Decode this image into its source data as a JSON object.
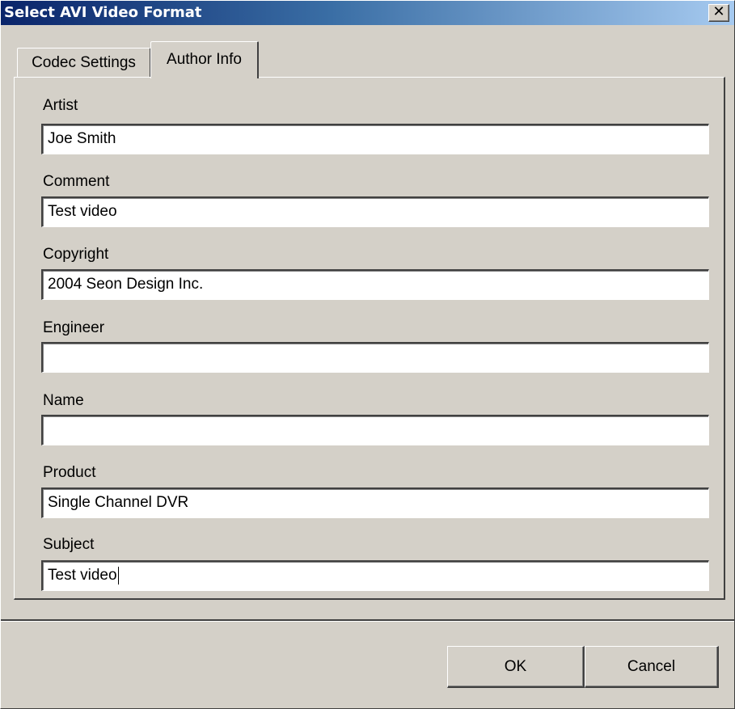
{
  "window": {
    "title": "Select AVI Video Format",
    "close_glyph": "✕"
  },
  "tabs": [
    {
      "label": "Codec Settings",
      "selected": false
    },
    {
      "label": "Author Info",
      "selected": true
    }
  ],
  "fields": [
    {
      "label": "Artist",
      "value": ""
    },
    {
      "label": "Comment",
      "value": ""
    },
    {
      "label": "Copyright",
      "value": ""
    },
    {
      "label": "Engineer",
      "value": ""
    },
    {
      "label": "Name",
      "value": ""
    },
    {
      "label": "Product",
      "value": ""
    },
    {
      "label": "Subject",
      "value": ""
    }
  ],
  "field_values": {
    "artist": "Joe Smith",
    "comment": "Test video",
    "copyright": "2004 Seon Design Inc.",
    "engineer": "",
    "name": "",
    "product": "Single Channel DVR",
    "subject": "Test video"
  },
  "buttons": {
    "ok_label": "OK",
    "cancel_label": "Cancel"
  },
  "colors": {
    "title_gradient_start": "#0a246a",
    "title_gradient_end": "#a6caf0",
    "face": "#d4d0c8"
  }
}
